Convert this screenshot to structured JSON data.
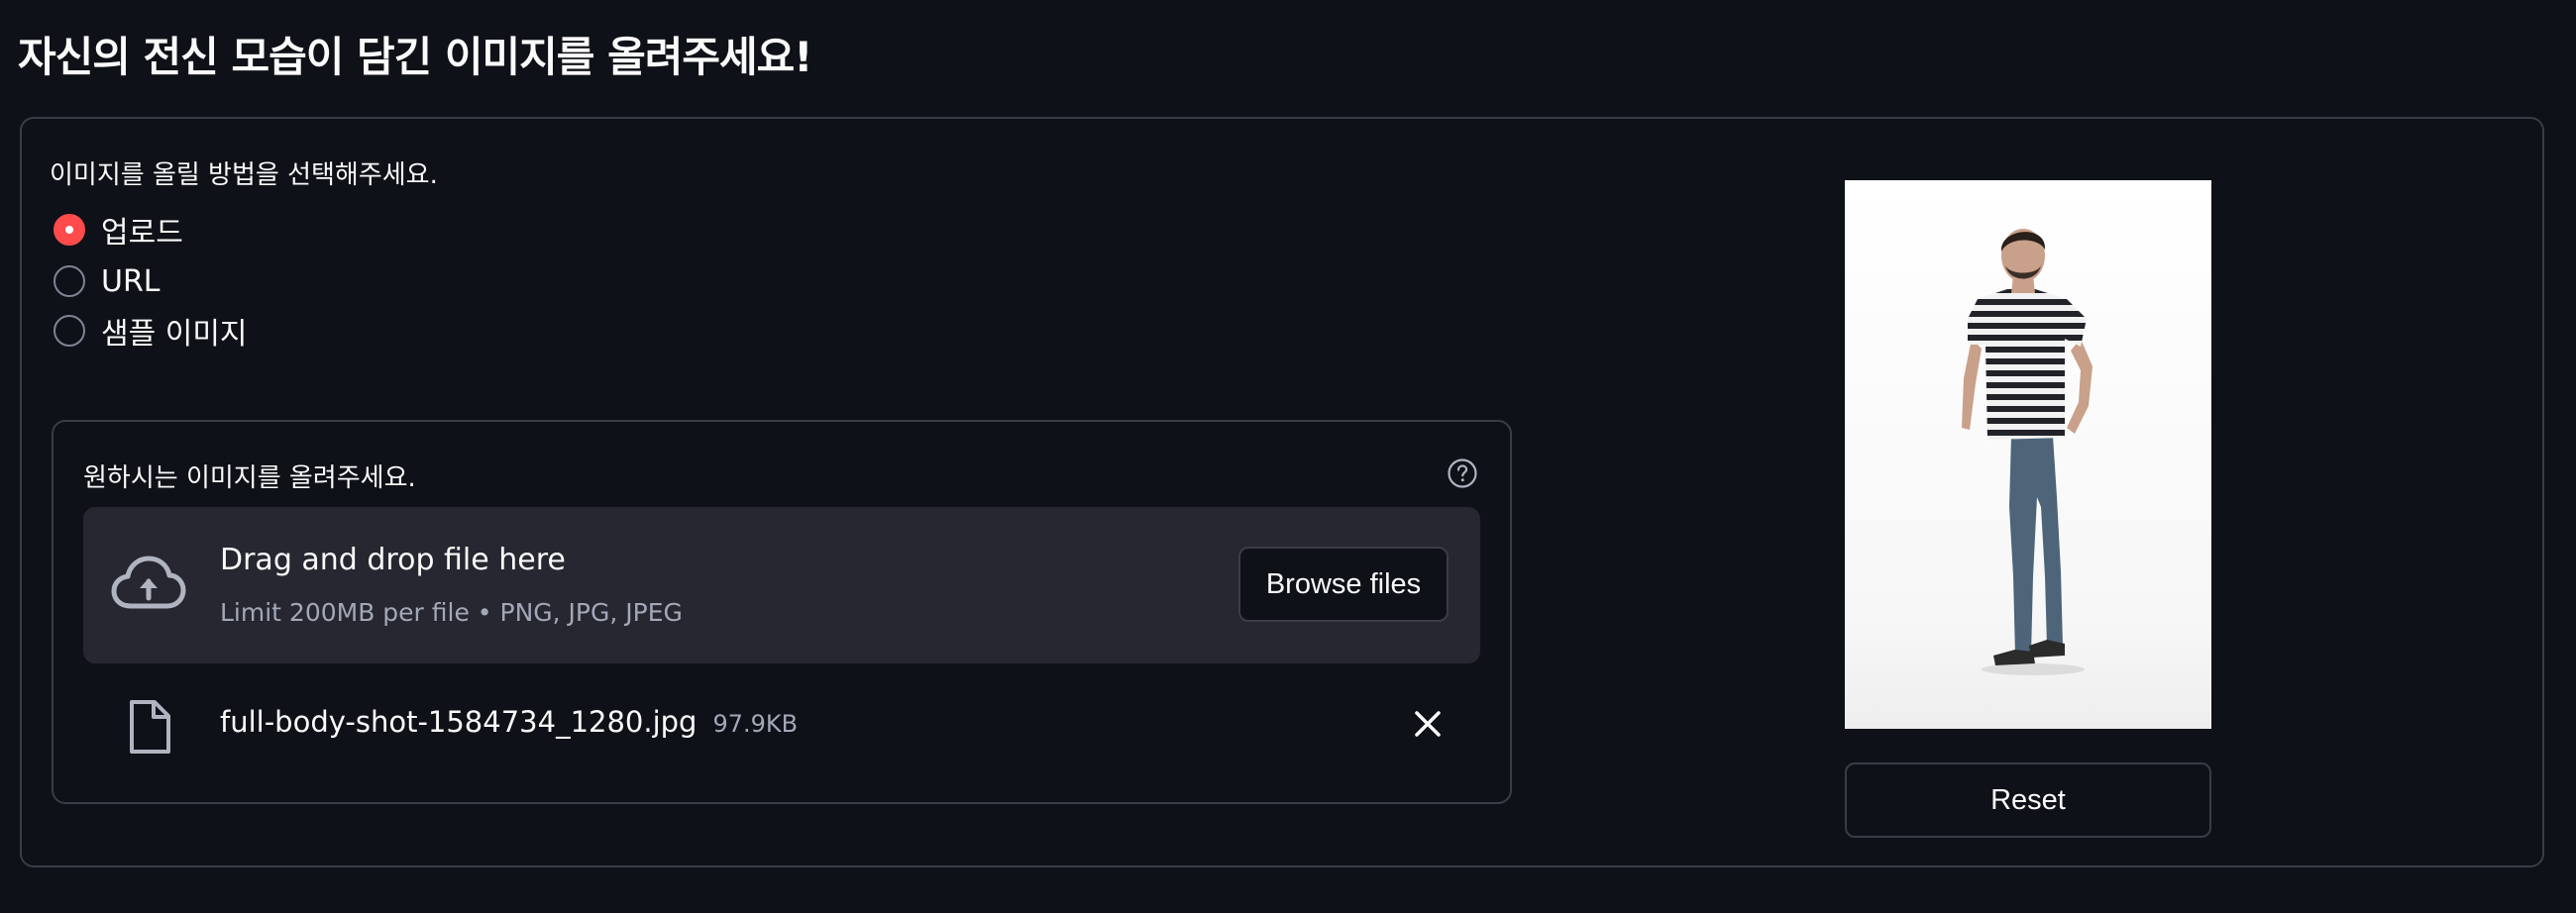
{
  "page": {
    "title": "자신의 전신 모습이 담긴 이미지를 올려주세요!"
  },
  "source_selector": {
    "prompt": "이미지를 올릴 방법을 선택해주세요.",
    "options": [
      {
        "label": "업로드",
        "selected": true
      },
      {
        "label": "URL",
        "selected": false
      },
      {
        "label": "샘플 이미지",
        "selected": false
      }
    ]
  },
  "uploader": {
    "label": "원하시는 이미지를 올려주세요.",
    "help_icon": "question-circle-icon",
    "dropzone_icon": "cloud-upload-icon",
    "dropzone_title": "Drag and drop file here",
    "dropzone_limit": "Limit 200MB per file • PNG, JPG, JPEG",
    "browse_label": "Browse files",
    "file": {
      "icon": "file-icon",
      "name": "full-body-shot-1584734_1280.jpg",
      "size": "97.9KB",
      "remove_icon": "close-icon"
    }
  },
  "preview": {
    "reset_label": "Reset"
  },
  "colors": {
    "background": "#0e1117",
    "accent": "#ff4b4b",
    "panel_border": "#3a3d47",
    "dropzone": "#262730",
    "muted_text": "#a3a8b8"
  }
}
